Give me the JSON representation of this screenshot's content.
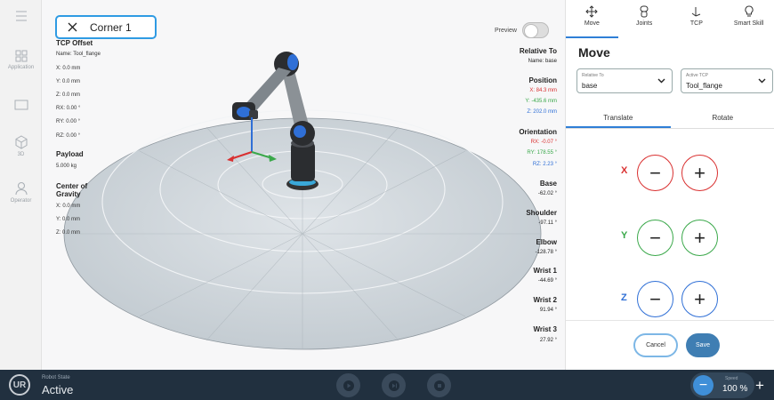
{
  "sidebar": {
    "items": [
      {
        "label": "Application",
        "icon": "grid-icon"
      },
      {
        "label": "",
        "icon": "window-icon"
      },
      {
        "label": "3D",
        "icon": "cube-icon"
      },
      {
        "label": "Operator",
        "icon": "person-icon"
      }
    ]
  },
  "header": {
    "title": "Corner 1",
    "close_icon": "close-icon"
  },
  "tcp": {
    "heading": "TCP Offset",
    "name": "Name: Tool_flange",
    "x": "X: 0.0 mm",
    "y": "Y: 0.0 mm",
    "z": "Z: 0.0 mm",
    "rx": "RX: 0.00 °",
    "ry": "RY: 0.00 °",
    "rz": "RZ: 0.00 °"
  },
  "payload": {
    "heading": "Payload",
    "value": "5.000 kg"
  },
  "cog": {
    "heading1": "Center of",
    "heading2": "Gravity",
    "x": "X: 0.0 mm",
    "y": "Y: 0.0 mm",
    "z": "Z: 0.0 mm"
  },
  "preview": {
    "label": "Preview",
    "on": false
  },
  "right": {
    "relative_heading": "Relative To",
    "relative_name": "Name: base",
    "position_heading": "Position",
    "pos_x": "X: 84.3 mm",
    "pos_y": "Y: -435.6 mm",
    "pos_z": "Z: 202.0 mm",
    "orientation_heading": "Orientation",
    "rx": "RX: -0.07 °",
    "ry": "RY: 178.55 °",
    "rz": "RZ: 2.23 °",
    "joints": [
      {
        "name": "Base",
        "value": "-62.02 °"
      },
      {
        "name": "Shoulder",
        "value": "-97.11 °"
      },
      {
        "name": "Elbow",
        "value": "-128.78 °"
      },
      {
        "name": "Wrist 1",
        "value": "-44.69 °"
      },
      {
        "name": "Wrist 2",
        "value": "91.94 °"
      },
      {
        "name": "Wrist 3",
        "value": "27.92 °"
      }
    ]
  },
  "panel": {
    "tabs": [
      {
        "label": "Move",
        "icon": "move-icon"
      },
      {
        "label": "Joints",
        "icon": "joints-icon"
      },
      {
        "label": "TCP",
        "icon": "tcp-icon"
      },
      {
        "label": "Smart Skill",
        "icon": "bulb-icon"
      }
    ],
    "title": "Move",
    "relative_to": {
      "caption": "Relative To",
      "value": "base"
    },
    "active_tcp": {
      "caption": "Active TCP",
      "value": "Tool_flange"
    },
    "subtabs": [
      "Translate",
      "Rotate"
    ],
    "axes": [
      {
        "label": "X",
        "color": "#d93030"
      },
      {
        "label": "Y",
        "color": "#3aa84a"
      },
      {
        "label": "Z",
        "color": "#2f6fd6"
      }
    ],
    "minus": "−",
    "plus": "+",
    "cancel": "Cancel",
    "save": "Save"
  },
  "bottom": {
    "state_caption": "Robot State",
    "state_value": "Active",
    "logo": "UR",
    "speed_caption": "Speed",
    "speed_value": "100 %",
    "speed_minus": "−",
    "speed_plus": "+"
  }
}
